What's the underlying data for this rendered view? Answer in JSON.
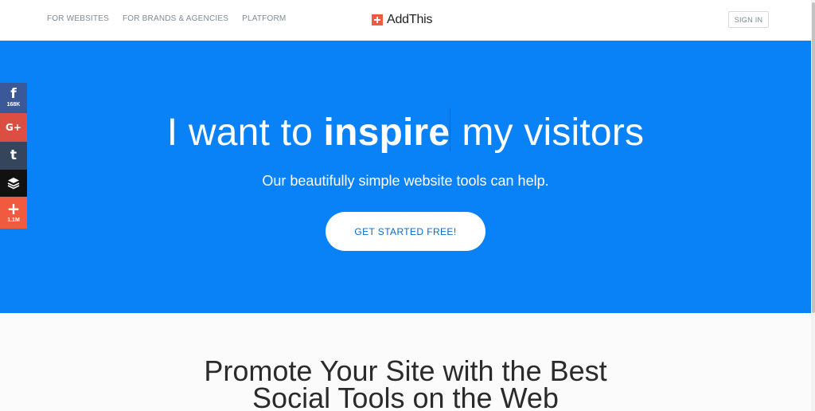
{
  "nav": {
    "links": [
      "FOR WEBSITES",
      "FOR BRANDS & AGENCIES",
      "PLATFORM"
    ],
    "logo_text": "AddThis",
    "signin_label": "SIGN IN"
  },
  "hero": {
    "headline_prefix": "I want to",
    "headline_strong": "inspire",
    "headline_suffix": "my visitors",
    "subhead": "Our beautifully simple website tools can help.",
    "cta_label": "GET STARTED FREE!",
    "background_color": "#0a82f7"
  },
  "share": {
    "buttons": [
      {
        "icon": "facebook-icon",
        "glyph": "f",
        "count": "168K",
        "color": "#3b5998"
      },
      {
        "icon": "google-plus-icon",
        "glyph": "G+",
        "count": "",
        "color": "#dc4e41"
      },
      {
        "icon": "tumblr-icon",
        "glyph": "t",
        "count": "",
        "color": "#35465c"
      },
      {
        "icon": "buffer-icon",
        "glyph": "",
        "count": "",
        "color": "#111111"
      },
      {
        "icon": "addthis-more-icon",
        "glyph": "+",
        "count": "1.1M",
        "color": "#f05a3e"
      }
    ]
  },
  "section": {
    "title_line1": "Promote Your Site with the Best",
    "title_line2": "Social Tools on the Web"
  }
}
